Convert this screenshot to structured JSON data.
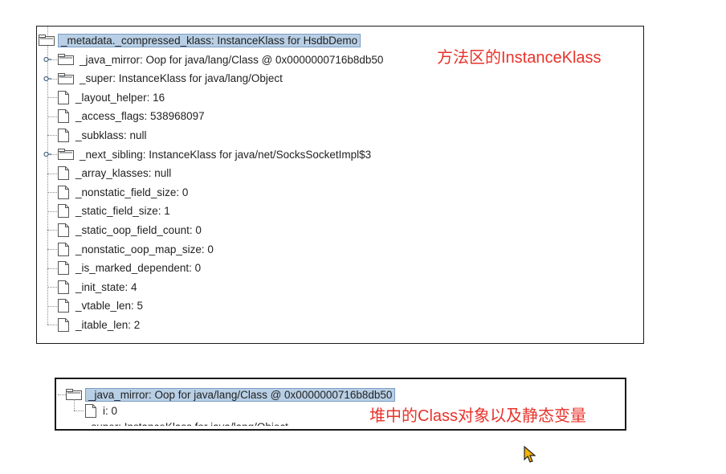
{
  "panel1": {
    "root_label": "_metadata._compressed_klass: InstanceKlass for HsdbDemo",
    "annotation": "方法区的InstanceKlass",
    "children": [
      {
        "label": "_java_mirror: Oop for java/lang/Class @ 0x0000000716b8db50",
        "icon": "folder-icon",
        "expandable": true
      },
      {
        "label": "_super: InstanceKlass for java/lang/Object",
        "icon": "folder-icon",
        "expandable": true
      },
      {
        "label": "_layout_helper: 16",
        "icon": "file-icon",
        "expandable": false
      },
      {
        "label": "_access_flags: 538968097",
        "icon": "file-icon",
        "expandable": false
      },
      {
        "label": "_subklass: null",
        "icon": "file-icon",
        "expandable": false
      },
      {
        "label": "_next_sibling: InstanceKlass for java/net/SocksSocketImpl$3",
        "icon": "folder-icon",
        "expandable": true
      },
      {
        "label": "_array_klasses: null",
        "icon": "file-icon",
        "expandable": false
      },
      {
        "label": "_nonstatic_field_size: 0",
        "icon": "file-icon",
        "expandable": false
      },
      {
        "label": "_static_field_size: 1",
        "icon": "file-icon",
        "expandable": false
      },
      {
        "label": "_static_oop_field_count: 0",
        "icon": "file-icon",
        "expandable": false
      },
      {
        "label": "_nonstatic_oop_map_size: 0",
        "icon": "file-icon",
        "expandable": false
      },
      {
        "label": "_is_marked_dependent: 0",
        "icon": "file-icon",
        "expandable": false
      },
      {
        "label": "_init_state: 4",
        "icon": "file-icon",
        "expandable": false
      },
      {
        "label": "_vtable_len: 5",
        "icon": "file-icon",
        "expandable": false
      },
      {
        "label": "_itable_len: 2",
        "icon": "file-icon",
        "expandable": false
      }
    ]
  },
  "panel2": {
    "root_label": "_java_mirror: Oop for java/lang/Class @ 0x0000000716b8db50",
    "child_label": "i: 0",
    "cut_label": "_super: InstanceKlass for java/lang/Object",
    "annotation": "堆中的Class对象以及静态变量"
  },
  "colors": {
    "annotation": "#e8332b",
    "selection_bg": "#b8cfe5",
    "selection_border": "#7a9cc4",
    "border": "#1a1a1a"
  }
}
